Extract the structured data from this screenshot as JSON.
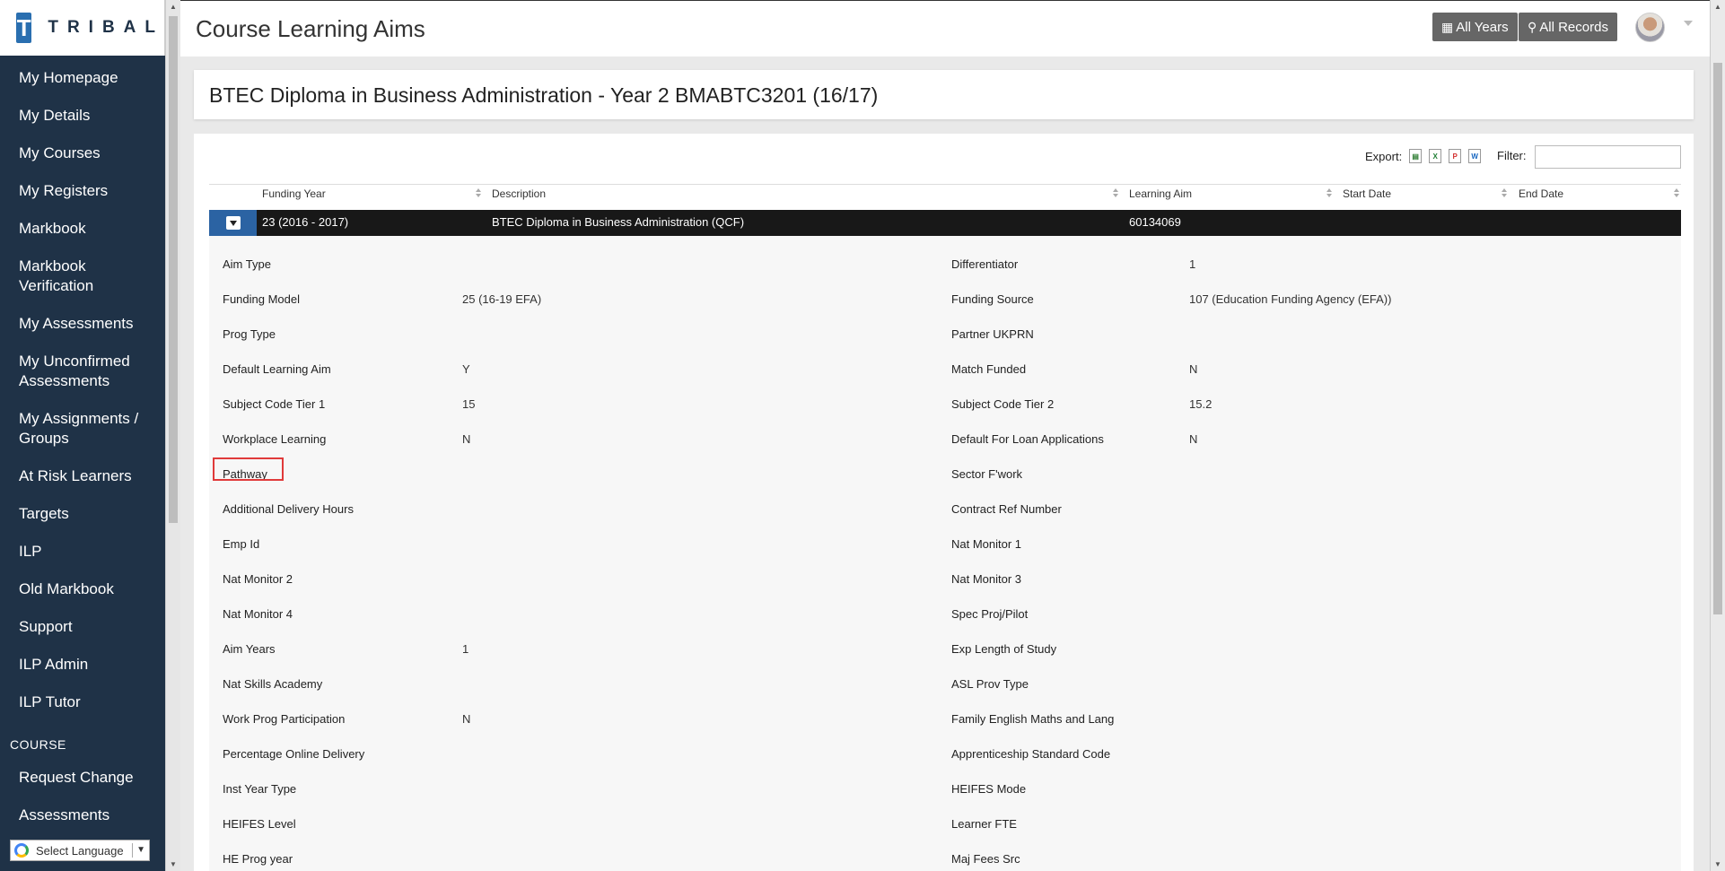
{
  "brand": {
    "logo_letter": "T",
    "logo_text": "TRIBAL"
  },
  "sidebar": {
    "items": [
      {
        "label": "My Homepage"
      },
      {
        "label": "My Details"
      },
      {
        "label": "My Courses"
      },
      {
        "label": "My Registers"
      },
      {
        "label": "Markbook"
      },
      {
        "label": "Markbook Verification"
      },
      {
        "label": "My Assessments"
      },
      {
        "label": "My Unconfirmed Assessments"
      },
      {
        "label": "My Assignments / Groups"
      },
      {
        "label": "At Risk Learners"
      },
      {
        "label": "Targets"
      },
      {
        "label": "ILP"
      },
      {
        "label": "Old Markbook"
      },
      {
        "label": "Support"
      },
      {
        "label": "ILP Admin"
      },
      {
        "label": "ILP Tutor"
      }
    ],
    "section_label": "COURSE",
    "section_items": [
      {
        "label": "Request Change"
      },
      {
        "label": "Assessments"
      }
    ],
    "language_label": "Select Language"
  },
  "header": {
    "title": "Course Learning Aims",
    "all_years_label": "All Years",
    "all_records_label": "All Records"
  },
  "course": {
    "title": "BTEC Diploma in Business Administration - Year 2 BMABTC3201 (16/17)"
  },
  "toolbar": {
    "export_label": "Export:",
    "filter_label": "Filter:",
    "filter_value": ""
  },
  "table": {
    "columns": [
      "Funding Year",
      "Description",
      "Learning Aim",
      "Start Date",
      "End Date"
    ],
    "row": {
      "funding_year": "23 (2016 - 2017)",
      "description": "BTEC Diploma in Business Administration (QCF)",
      "learning_aim": "60134069",
      "start_date": "",
      "end_date": ""
    }
  },
  "details_left": [
    {
      "label": "Aim Type",
      "value": ""
    },
    {
      "label": "Funding Model",
      "value": "25 (16-19 EFA)"
    },
    {
      "label": "Prog Type",
      "value": ""
    },
    {
      "label": "Default Learning Aim",
      "value": "Y"
    },
    {
      "label": "Subject Code Tier 1",
      "value": "15"
    },
    {
      "label": "Workplace Learning",
      "value": "N"
    },
    {
      "label": "Pathway",
      "value": ""
    },
    {
      "label": "Additional Delivery Hours",
      "value": ""
    },
    {
      "label": "Emp Id",
      "value": ""
    },
    {
      "label": "Nat Monitor 2",
      "value": ""
    },
    {
      "label": "Nat Monitor 4",
      "value": ""
    },
    {
      "label": "Aim Years",
      "value": "1"
    },
    {
      "label": "Nat Skills Academy",
      "value": ""
    },
    {
      "label": "Work Prog Participation",
      "value": "N"
    },
    {
      "label": "Percentage Online Delivery",
      "value": ""
    },
    {
      "label": "Inst Year Type",
      "value": ""
    },
    {
      "label": "HEIFES Level",
      "value": ""
    },
    {
      "label": "HE Prog year",
      "value": ""
    }
  ],
  "details_right": [
    {
      "label": "Differentiator",
      "value": "1"
    },
    {
      "label": "Funding Source",
      "value": "107 (Education Funding Agency (EFA))"
    },
    {
      "label": "Partner UKPRN",
      "value": ""
    },
    {
      "label": "Match Funded",
      "value": "N"
    },
    {
      "label": "Subject Code Tier 2",
      "value": "15.2"
    },
    {
      "label": "Default For Loan Applications",
      "value": "N"
    },
    {
      "label": "Sector F'work",
      "value": ""
    },
    {
      "label": "Contract Ref Number",
      "value": ""
    },
    {
      "label": "Nat Monitor 1",
      "value": ""
    },
    {
      "label": "Nat Monitor 3",
      "value": ""
    },
    {
      "label": "Spec Proj/Pilot",
      "value": ""
    },
    {
      "label": "Exp Length of Study",
      "value": ""
    },
    {
      "label": "ASL Prov Type",
      "value": ""
    },
    {
      "label": "Family English Maths and Lang",
      "value": ""
    },
    {
      "label": "Apprenticeship Standard Code",
      "value": ""
    },
    {
      "label": "HEIFES Mode",
      "value": ""
    },
    {
      "label": "Learner FTE",
      "value": ""
    },
    {
      "label": "Maj Fees Src",
      "value": ""
    }
  ],
  "colors": {
    "sidebar_bg": "#1f3247",
    "accent": "#2b63a3",
    "row_bg": "#181818",
    "highlight": "#e03a3a"
  }
}
